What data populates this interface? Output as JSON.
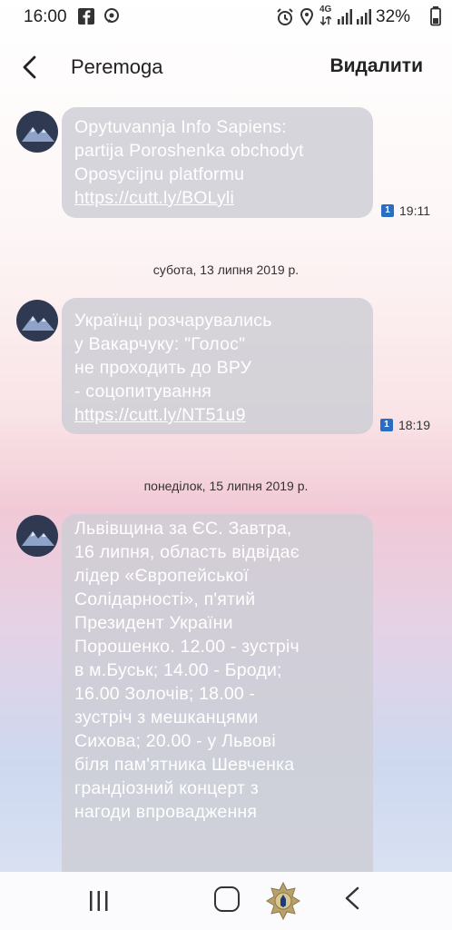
{
  "status_bar": {
    "time": "16:00",
    "network": "4G",
    "battery": "32%"
  },
  "header": {
    "title": "Peremoga",
    "delete_label": "Видалити"
  },
  "messages": [
    {
      "lines": [
        "Opytuvannja Info Sapiens:",
        "partija Poroshenka obchodyt",
        "Oposycijnu platformu"
      ],
      "link": "https://cutt.ly/BOLyli",
      "sim": "1",
      "time": "19:11"
    },
    {
      "lines": [
        "Українці розчарувались",
        "у Вакарчуку: \"Голос\"",
        "не проходить до ВРУ",
        "- соцопитування"
      ],
      "link": "https://cutt.ly/NT51u9",
      "sim": "1",
      "time": "18:19"
    },
    {
      "lines": [
        "Львівщина за ЄС. Завтра,",
        "16 липня, область відвідає",
        "лідер «Європейської",
        "Солідарності», п'ятий",
        "Президент України",
        "Порошенко. 12.00 - зустріч",
        "в м.Буськ; 14.00 - Броди;",
        "16.00 Золочів; 18.00 -",
        "зустріч з мешканцями",
        "Сихова; 20.00 - у Львові",
        "біля пам'ятника Шевченка",
        "грандіозний концерт з",
        "нагоди впровадження"
      ]
    }
  ],
  "dates": [
    "субота, 13 липня 2019 р.",
    "понеділок, 15 липня 2019 р."
  ],
  "colors": {
    "bubble": "#cdcdd4",
    "sim_badge": "#2a6ec3",
    "avatar": "#2f3a52"
  }
}
